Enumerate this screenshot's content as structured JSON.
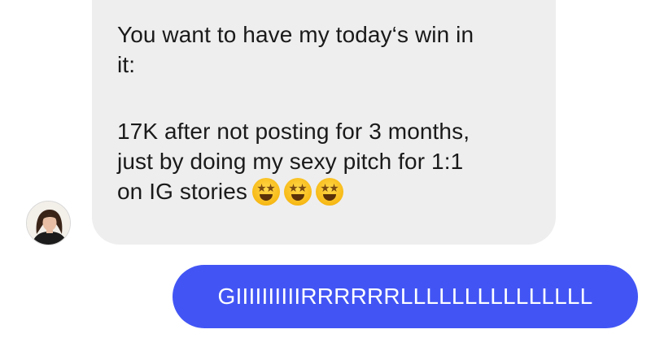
{
  "thread": {
    "received_message": {
      "line1": "You want to have my today‘s win in",
      "line2": "it:",
      "line3": "17K after not posting for 3 months,",
      "line4": "just by doing my sexy pitch for 1:1",
      "line5": "on IG stories",
      "emojis": [
        "star-struck",
        "star-struck",
        "star-struck"
      ],
      "bubble_color": "#eeeeee"
    },
    "sent_message": {
      "text": "GIIIIIIIIIIRRRRRRLLLLLLLLLLLLLLL",
      "bubble_color": "#4255f4"
    }
  }
}
